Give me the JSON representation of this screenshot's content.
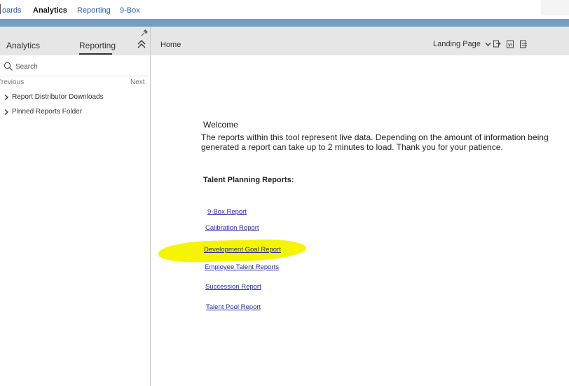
{
  "topnav": {
    "items": [
      {
        "label": "oards",
        "active": false
      },
      {
        "label": "Analytics",
        "active": true
      },
      {
        "label": "Reporting",
        "active": false
      },
      {
        "label": "9-Box",
        "active": false
      }
    ]
  },
  "sidebar": {
    "tabs": [
      {
        "label": "Analytics",
        "selected": false
      },
      {
        "label": "Reporting",
        "selected": true
      }
    ],
    "pin_icon": "pin-icon",
    "collapse_icon": "double-chevron-up-icon",
    "search": {
      "placeholder": "Search",
      "value": "",
      "icon": "search-icon"
    },
    "pager": {
      "previous": "'revious",
      "next": "Next"
    },
    "tree": [
      {
        "label": "Report Distributor Downloads",
        "icon": "chevron-right-icon"
      },
      {
        "label": "Pinned Reports Folder",
        "icon": "chevron-right-icon"
      }
    ]
  },
  "main": {
    "header": {
      "home_label": "Home",
      "landing_select": {
        "value": "Landing Page",
        "icon": "chevron-down-icon"
      },
      "icons": [
        "export-icon",
        "csv-icon",
        "print-icon"
      ]
    },
    "welcome": "Welcome",
    "intro": "The reports within this tool represent live data.  Depending on the amount of information being generated a report can take up to 2 minutes to load. Thank you for your patience.",
    "section_title": "Talent Planning Reports:",
    "reports": [
      {
        "label": "9-Box Report"
      },
      {
        "label": "Calibration Report"
      },
      {
        "label": "Development Goal Report",
        "highlighted": true
      },
      {
        "label": "Employee Talent Reports"
      },
      {
        "label": "Succession Report"
      },
      {
        "label": "Talent Pool Report"
      }
    ],
    "highlight_color": "#f5f500"
  },
  "colors": {
    "top_bar": "#6fa0cb",
    "panel_header": "#e6e6e6",
    "link": "#2a2aa8"
  }
}
